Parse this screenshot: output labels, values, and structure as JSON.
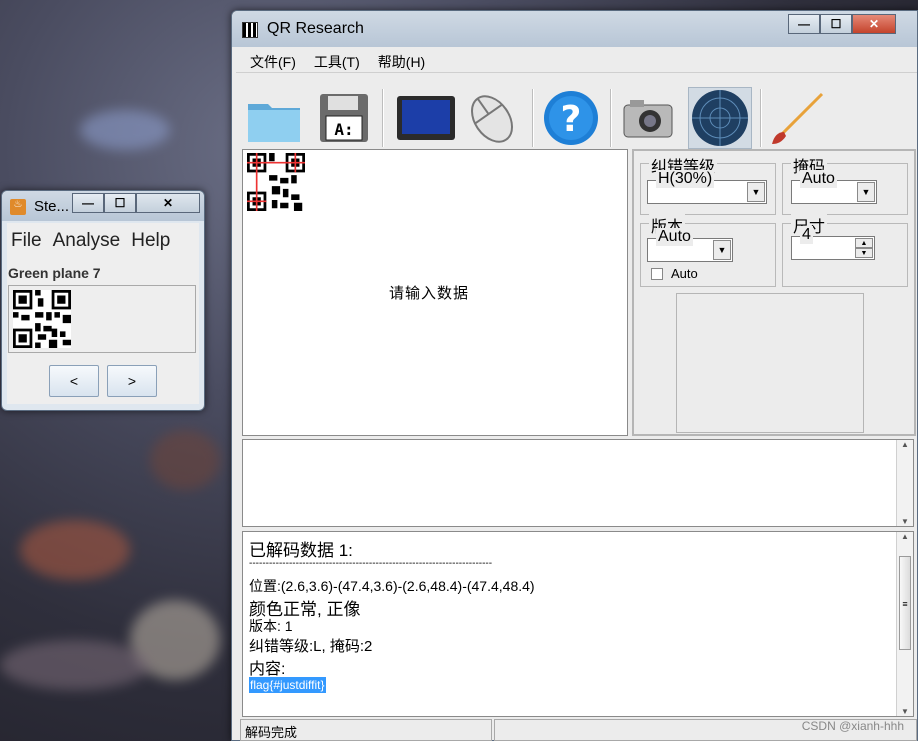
{
  "stego": {
    "title": "Ste...",
    "menu": [
      "File",
      "Analyse",
      "Help"
    ],
    "plane_label": "Green plane 7",
    "prev_label": "<",
    "next_label": ">"
  },
  "qr": {
    "title": "QR Research",
    "menu": [
      "文件(F)",
      "工具(T)",
      "帮助(H)"
    ],
    "toolbar": [
      "folder-icon",
      "floppy-disk-icon",
      "monitor-icon",
      "mouse-icon",
      "help-icon",
      "camera-icon",
      "radar-icon",
      "paintbrush-icon"
    ],
    "input_placeholder": "请输入数据",
    "ec_group": "纠错等级",
    "ec_value": "H(30%)",
    "mask_group": "掩码",
    "mask_value": "Auto",
    "version_group": "版本",
    "version_value": "Auto",
    "auto_checkbox": "Auto",
    "size_group": "尺寸",
    "size_value": "4",
    "output": {
      "header": "已解码数据 1:",
      "divider": "-------------------------------------------------------------------------",
      "position": "位置:(2.6,3.6)-(47.4,3.6)-(2.6,48.4)-(47.4,48.4)",
      "color": "颜色正常, 正像",
      "version": "版本: 1",
      "ec_mask": "纠错等级:L, 掩码:2",
      "content_label": "内容:",
      "content_value": "flag{#justdiffit}"
    },
    "status": "解码完成"
  },
  "watermark": "CSDN @xianh-hhh"
}
